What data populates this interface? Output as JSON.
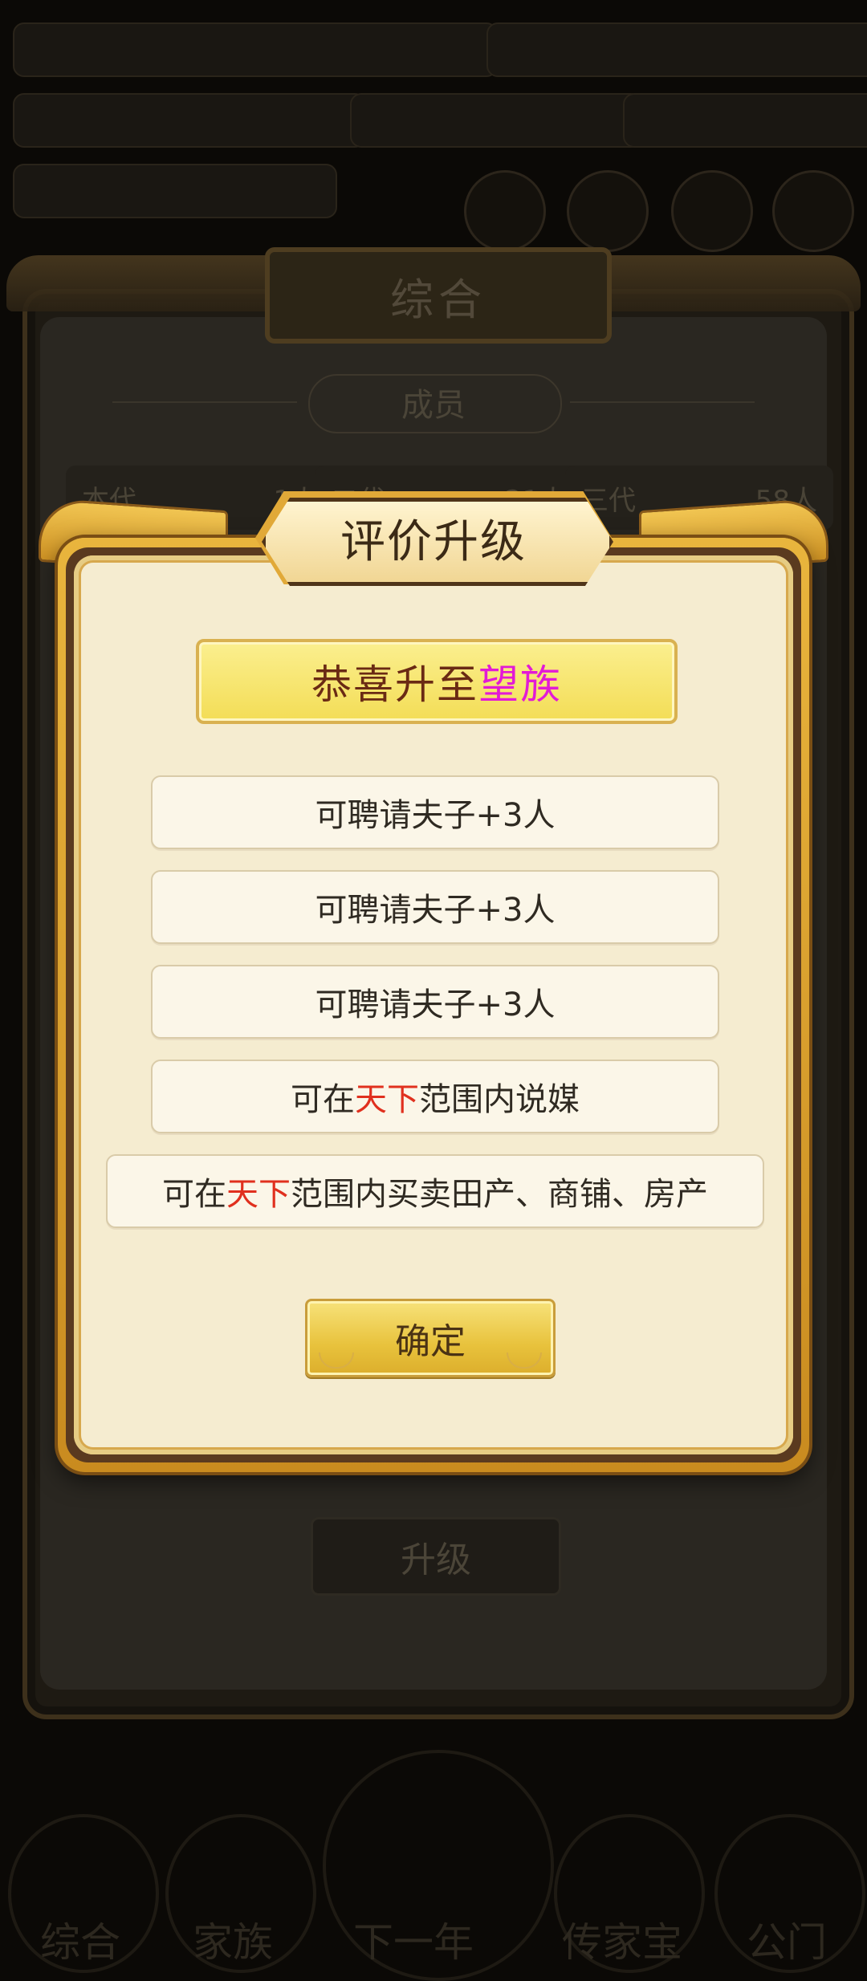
{
  "background": {
    "hud": {
      "top_left": "",
      "resources": [
        "",
        "",
        ""
      ],
      "row2_left": "",
      "row2_mid": "",
      "row3_left": ""
    },
    "panel_title": "综合",
    "section_title": "成员",
    "generations": [
      {
        "label": "本代",
        "count": "1人"
      },
      {
        "label": "二代",
        "count": "21人"
      },
      {
        "label": "三代",
        "count": "58人"
      }
    ],
    "upgrade_label": "升级",
    "bottom_nav": [
      "综合",
      "家族",
      "下一年",
      "传家宝",
      "公门"
    ]
  },
  "dialog": {
    "title": "评价升级",
    "congrats_prefix": "恭喜升至",
    "congrats_rank": "望族",
    "benefits": [
      {
        "pre": "可聘请夫子+3人",
        "hl": "",
        "post": ""
      },
      {
        "pre": "可聘请夫子+3人",
        "hl": "",
        "post": ""
      },
      {
        "pre": "可聘请夫子+3人",
        "hl": "",
        "post": ""
      },
      {
        "pre": "可在",
        "hl": "天下",
        "post": "范围内说媒"
      },
      {
        "pre": "可在",
        "hl": "天下",
        "post": "范围内买卖田产、商铺、房产"
      }
    ],
    "confirm_label": "确定"
  },
  "colors": {
    "rank_highlight": "#e21ad6",
    "scope_highlight": "#e0301e",
    "dialog_gold": "#e1a938"
  }
}
